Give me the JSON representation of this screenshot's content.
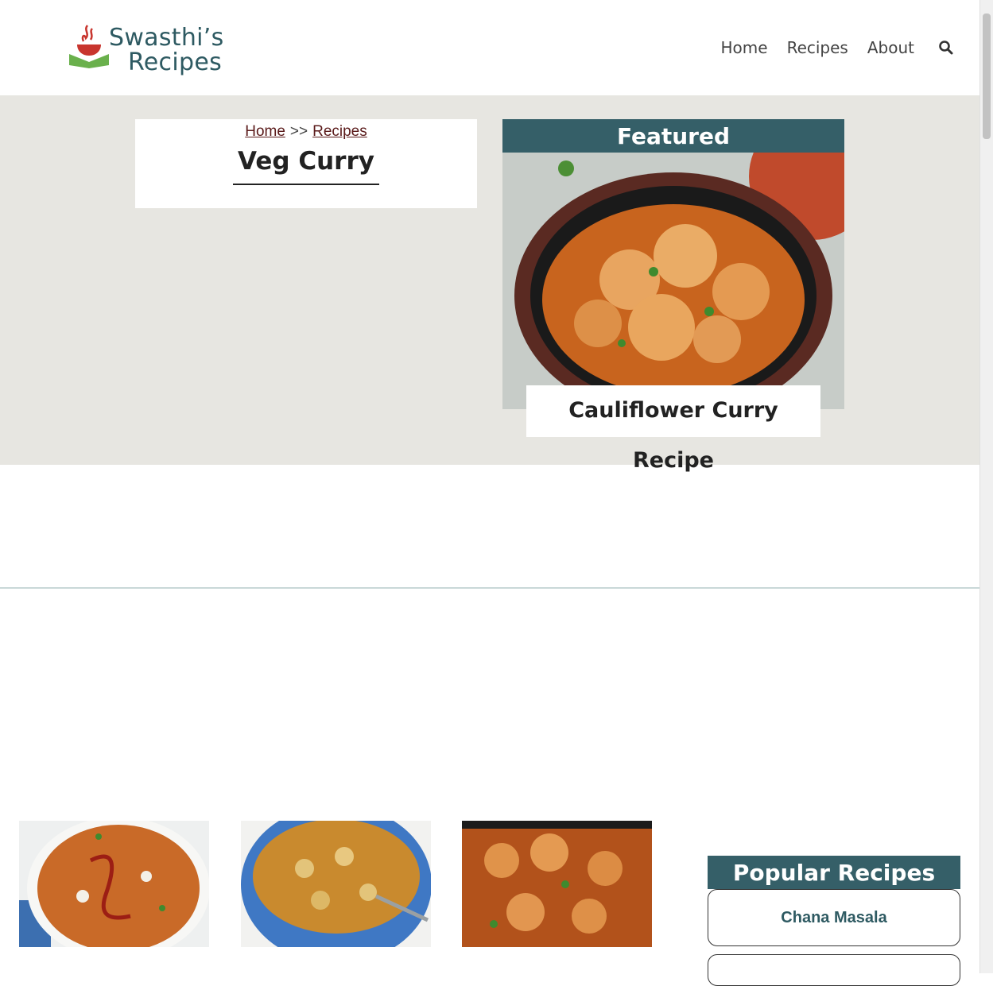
{
  "header": {
    "logo_line1": "Swasthi’s",
    "logo_line2": "Recipes",
    "nav": [
      {
        "label": "Home"
      },
      {
        "label": "Recipes"
      },
      {
        "label": "About"
      }
    ],
    "search_icon": "search-icon"
  },
  "hero": {
    "breadcrumb": {
      "home": "Home",
      "sep": ">>",
      "recipes": "Recipes"
    },
    "title": "Veg Curry",
    "featured_label": "Featured",
    "featured_caption": "Cauliflower Curry Recipe"
  },
  "popular": {
    "heading": "Popular Recipes",
    "items": [
      {
        "label": "Chana Masala"
      },
      {
        "label": ""
      }
    ]
  },
  "colors": {
    "accent": "#355f68",
    "hero_bg": "#e7e6e1",
    "logo_red": "#c8352e",
    "logo_green": "#6ab04c"
  }
}
